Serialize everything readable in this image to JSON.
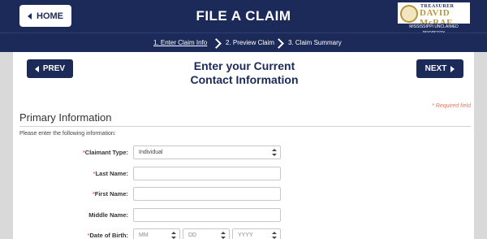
{
  "header": {
    "home_label": "HOME",
    "title": "FILE A CLAIM",
    "logo": {
      "top": "TREASURER",
      "name": "DAVID McRAE",
      "sub": "MISSISSIPPI UNCLAIMED PROPERTY"
    }
  },
  "steps": [
    {
      "label": "1. Enter Claim Info",
      "active": true
    },
    {
      "label": "2. Preview Claim",
      "active": false
    },
    {
      "label": "3. Claim Summary",
      "active": false
    }
  ],
  "nav": {
    "prev_label": "PREV",
    "next_label": "NEXT"
  },
  "page": {
    "heading_line1": "Enter your Current",
    "heading_line2": "Contact Information",
    "required_note": "* Required field",
    "section_title": "Primary Information",
    "intro": "Please enter the following information:"
  },
  "form": {
    "claimant_type": {
      "label": "Claimant Type:",
      "required": true,
      "value": "Individual"
    },
    "last_name": {
      "label": "Last Name:",
      "required": true,
      "value": ""
    },
    "first_name": {
      "label": "First Name:",
      "required": true,
      "value": ""
    },
    "middle_name": {
      "label": "Middle Name:",
      "required": false,
      "value": ""
    },
    "dob": {
      "label": "Date of Birth:",
      "required": true,
      "month_placeholder": "MM",
      "day_placeholder": "DD",
      "year_placeholder": "YYYY"
    }
  },
  "colors": {
    "brand_navy": "#1c2a5a",
    "accent_gold": "#b8973b",
    "required_orange": "#e07a5f"
  }
}
